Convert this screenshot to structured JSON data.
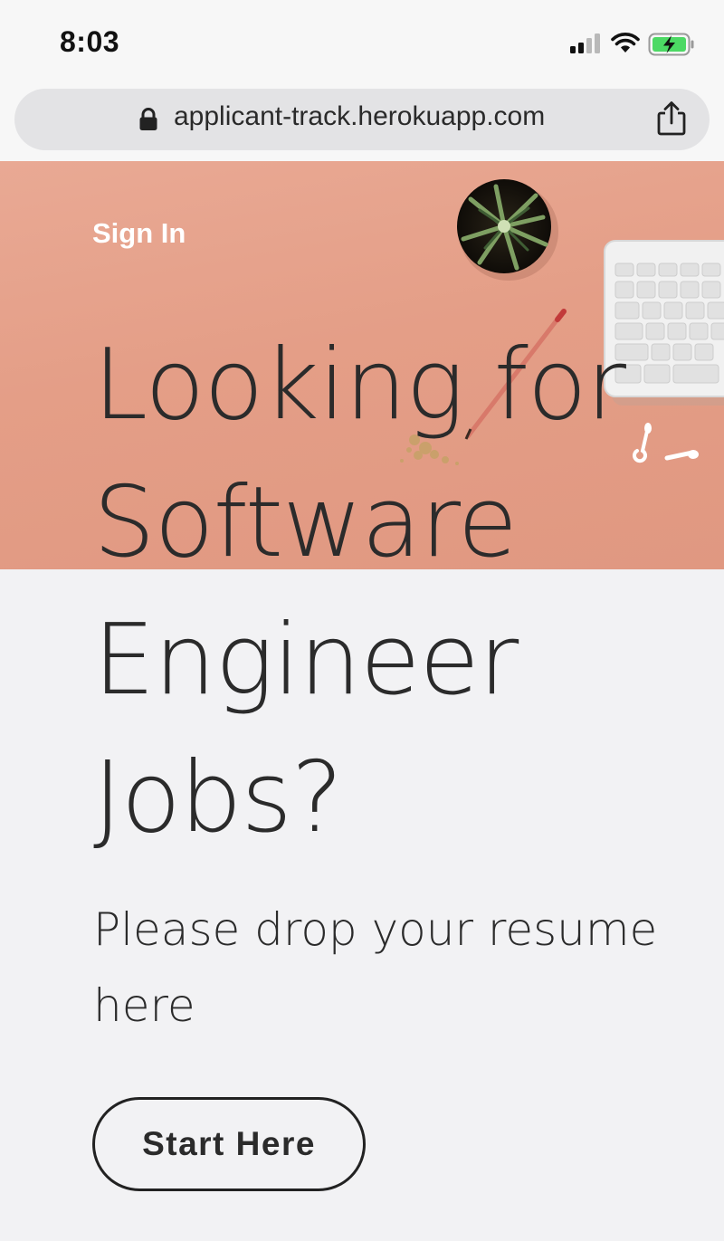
{
  "status_bar": {
    "time": "8:03",
    "icons": [
      "signal-icon",
      "wifi-icon",
      "battery-charging-icon"
    ],
    "battery_color": "#4cd964"
  },
  "browser": {
    "url": "applicant-track.herokuapp.com",
    "icons": [
      "lock-icon",
      "share-icon"
    ]
  },
  "hero": {
    "sign_in_label": "Sign In",
    "background_color": "#e49e87"
  },
  "headline": {
    "lines": [
      "Looking for",
      "Software",
      "Engineer",
      "Jobs?"
    ]
  },
  "subtext": "Please drop your resume here",
  "cta": {
    "label": "Start Here"
  }
}
